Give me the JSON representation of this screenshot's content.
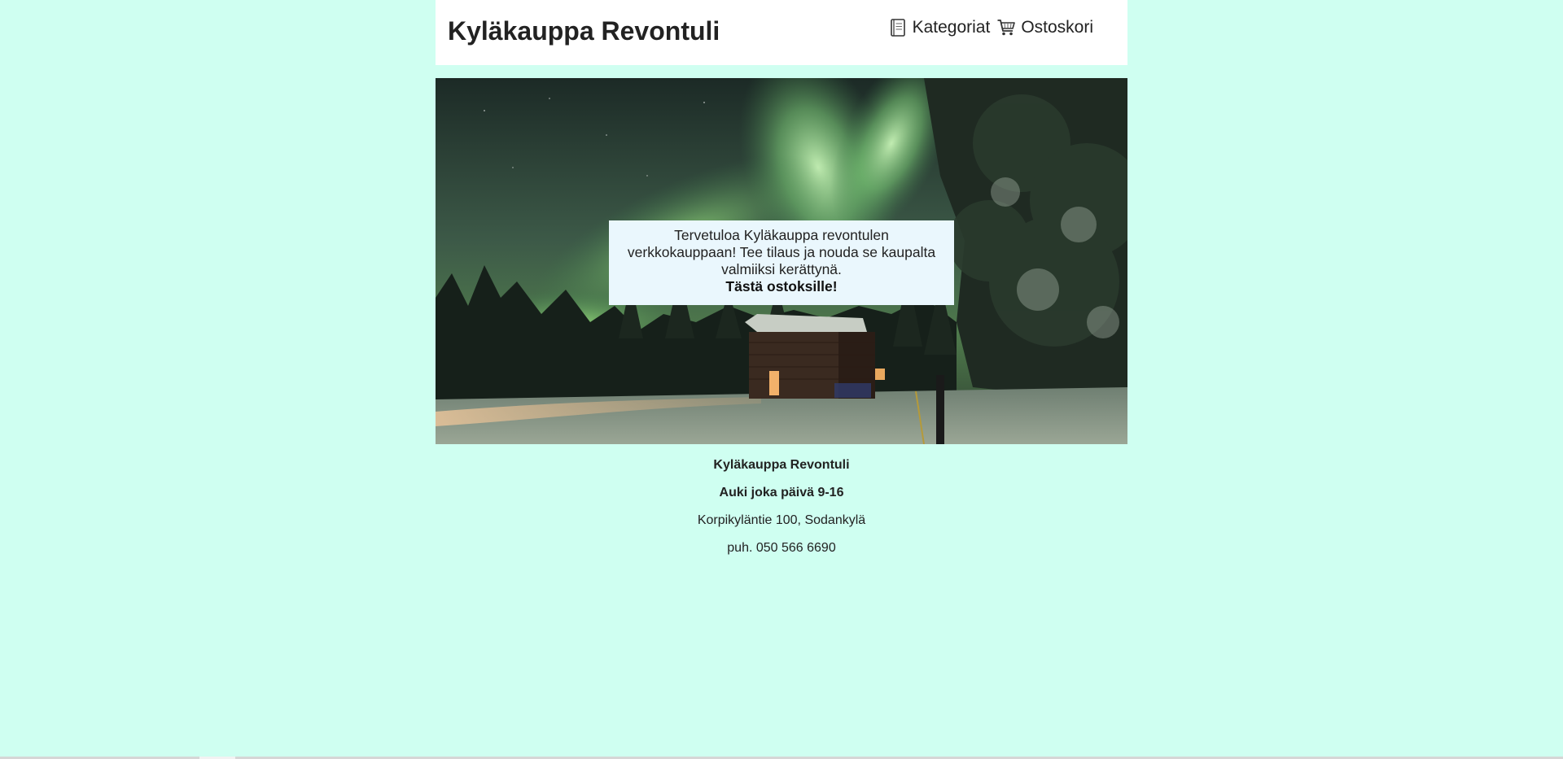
{
  "header": {
    "title": "Kyläkauppa Revontuli",
    "nav": [
      {
        "label": "Kategoriat",
        "icon": "menu-book-icon"
      },
      {
        "label": "Ostoskori",
        "icon": "shopping-cart-icon"
      }
    ]
  },
  "hero": {
    "image": "northern-lights-cabin-photo",
    "welcome_text": "Tervetuloa Kyläkauppa revontulen verkkokauppaan! Tee tilaus ja nouda se kaupalta valmiiksi kerättynä.",
    "cta_label": "Tästä ostoksille!"
  },
  "footer": {
    "store_name": "Kyläkauppa Revontuli",
    "hours": "Auki joka päivä 9-16",
    "address": "Korpikyläntie 100, Sodankylä",
    "phone": "puh. 050 566 6690"
  },
  "colors": {
    "page_background": "#cffff1",
    "header_background": "#ffffff",
    "welcome_box": "#eaf7fd",
    "text": "#222222"
  }
}
